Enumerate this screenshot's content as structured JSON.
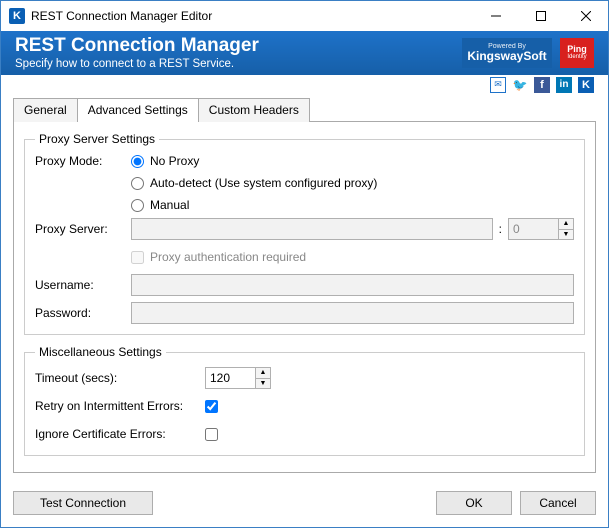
{
  "window": {
    "title": "REST Connection Manager Editor"
  },
  "banner": {
    "title": "REST Connection Manager",
    "subtitle": "Specify how to connect to a REST Service.",
    "powered_by": "Powered By",
    "kingsway": "KingswaySoft",
    "ping": "Ping",
    "ping_sub": "Identity"
  },
  "tabs": {
    "general": "General",
    "advanced": "Advanced Settings",
    "custom": "Custom Headers"
  },
  "proxy": {
    "legend": "Proxy Server Settings",
    "mode_label": "Proxy Mode:",
    "no_proxy": "No Proxy",
    "auto_detect": "Auto-detect (Use system configured proxy)",
    "manual": "Manual",
    "server_label": "Proxy Server:",
    "server_value": "",
    "port_value": "0",
    "auth_required": "Proxy authentication required",
    "username_label": "Username:",
    "username_value": "",
    "password_label": "Password:",
    "password_value": ""
  },
  "misc": {
    "legend": "Miscellaneous Settings",
    "timeout_label": "Timeout (secs):",
    "timeout_value": "120",
    "retry_label": "Retry on Intermittent Errors:",
    "ignore_label": "Ignore Certificate Errors:"
  },
  "footer": {
    "test": "Test Connection",
    "ok": "OK",
    "cancel": "Cancel"
  }
}
